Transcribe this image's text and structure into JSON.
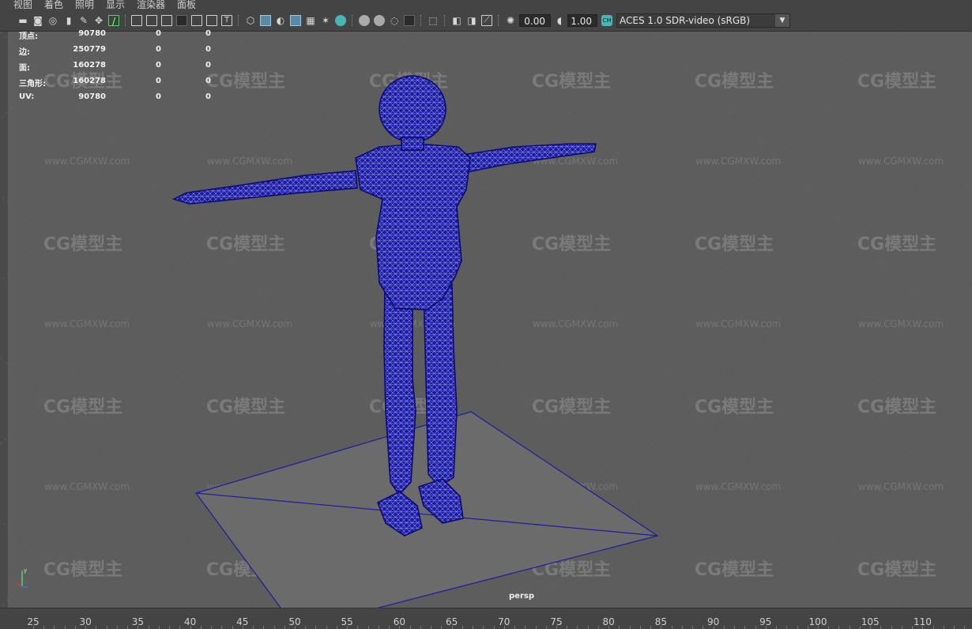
{
  "menu": [
    "视图",
    "着色",
    "照明",
    "显示",
    "渲染器",
    "面板"
  ],
  "toolbar": {
    "icons": [
      "select-camera-icon",
      "camera-attributes-icon",
      "bookmarks-icon",
      "image-plane-icon",
      "grease-pencil-icon",
      "move-camera-icon",
      "wireframe-pen-icon",
      "grid-icon",
      "film-gate-icon",
      "resolution-gate-icon",
      "gate-mask-icon",
      "field-chart-icon",
      "safe-title-icon",
      "wireframe-icon",
      "smooth-shade-icon",
      "flat-shade-icon",
      "wireframe-on-shaded-icon",
      "xray-icon",
      "bounding-box-icon",
      "use-all-lights-icon",
      "shadows-icon",
      "screen-space-ao-icon",
      "motion-blur-icon",
      "antialias-icon",
      "depth-of-field-icon",
      "isolate-select-icon",
      "xray-joints-icon",
      "xray-active-icon",
      "backface-icon",
      "exposure-icon",
      "gamma-icon",
      "color-management-icon"
    ],
    "exposure": "0.00",
    "gamma": "1.00",
    "color_space": "ACES 1.0 SDR-video (sRGB)"
  },
  "hud": [
    {
      "label": "顶点:",
      "v1": "90780",
      "v2": "0",
      "v3": "0"
    },
    {
      "label": "边:",
      "v1": "250779",
      "v2": "0",
      "v3": "0"
    },
    {
      "label": "面:",
      "v1": "160278",
      "v2": "0",
      "v3": "0"
    },
    {
      "label": "三角形:",
      "v1": "160278",
      "v2": "0",
      "v3": "0"
    },
    {
      "label": "UV:",
      "v1": "90780",
      "v2": "0",
      "v3": "0"
    }
  ],
  "watermark": {
    "logo": "CG模型主",
    "url": "www.CGMXW.com"
  },
  "camera_label": "persp",
  "timeline": {
    "ticks": [
      "25",
      "30",
      "35",
      "40",
      "45",
      "50",
      "55",
      "60",
      "65",
      "70",
      "75",
      "80",
      "85",
      "90",
      "95",
      "100",
      "105",
      "110"
    ]
  },
  "colors": {
    "wire": "#0d0d86",
    "accent": "#49b5b5"
  }
}
